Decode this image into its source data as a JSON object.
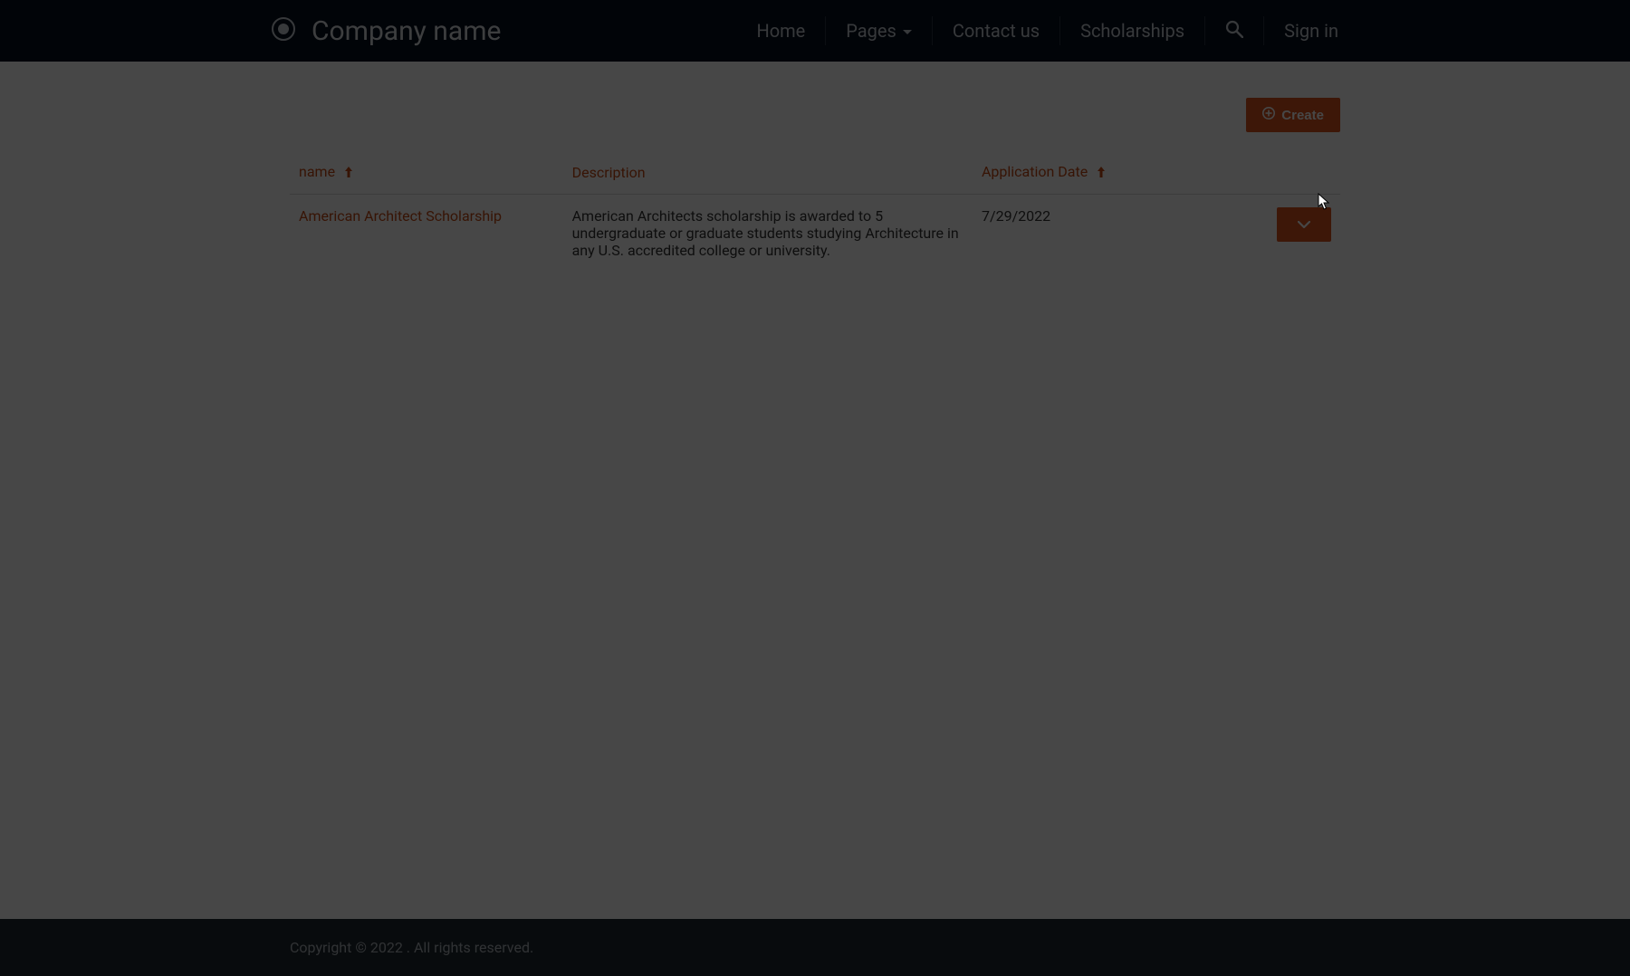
{
  "brand": {
    "name": "Company name"
  },
  "nav": {
    "home": "Home",
    "pages": "Pages",
    "contact": "Contact us",
    "scholarships": "Scholarships",
    "signin": "Sign in"
  },
  "toolbar": {
    "create_label": "Create"
  },
  "table": {
    "headers": {
      "name": "name",
      "description": "Description",
      "application_date": "Application Date"
    },
    "rows": [
      {
        "name": "American Architect Scholarship",
        "description": "American Architects scholarship is awarded to 5 undergraduate or graduate students studying Architecture in any U.S. accredited college or university.",
        "date": "7/29/2022"
      }
    ]
  },
  "footer": {
    "text": "Copyright © 2022 . All rights reserved."
  },
  "colors": {
    "accent": "#d9531e",
    "link": "#c54a14",
    "header_bg": "#07111f",
    "footer_bg": "#1f2a30"
  }
}
